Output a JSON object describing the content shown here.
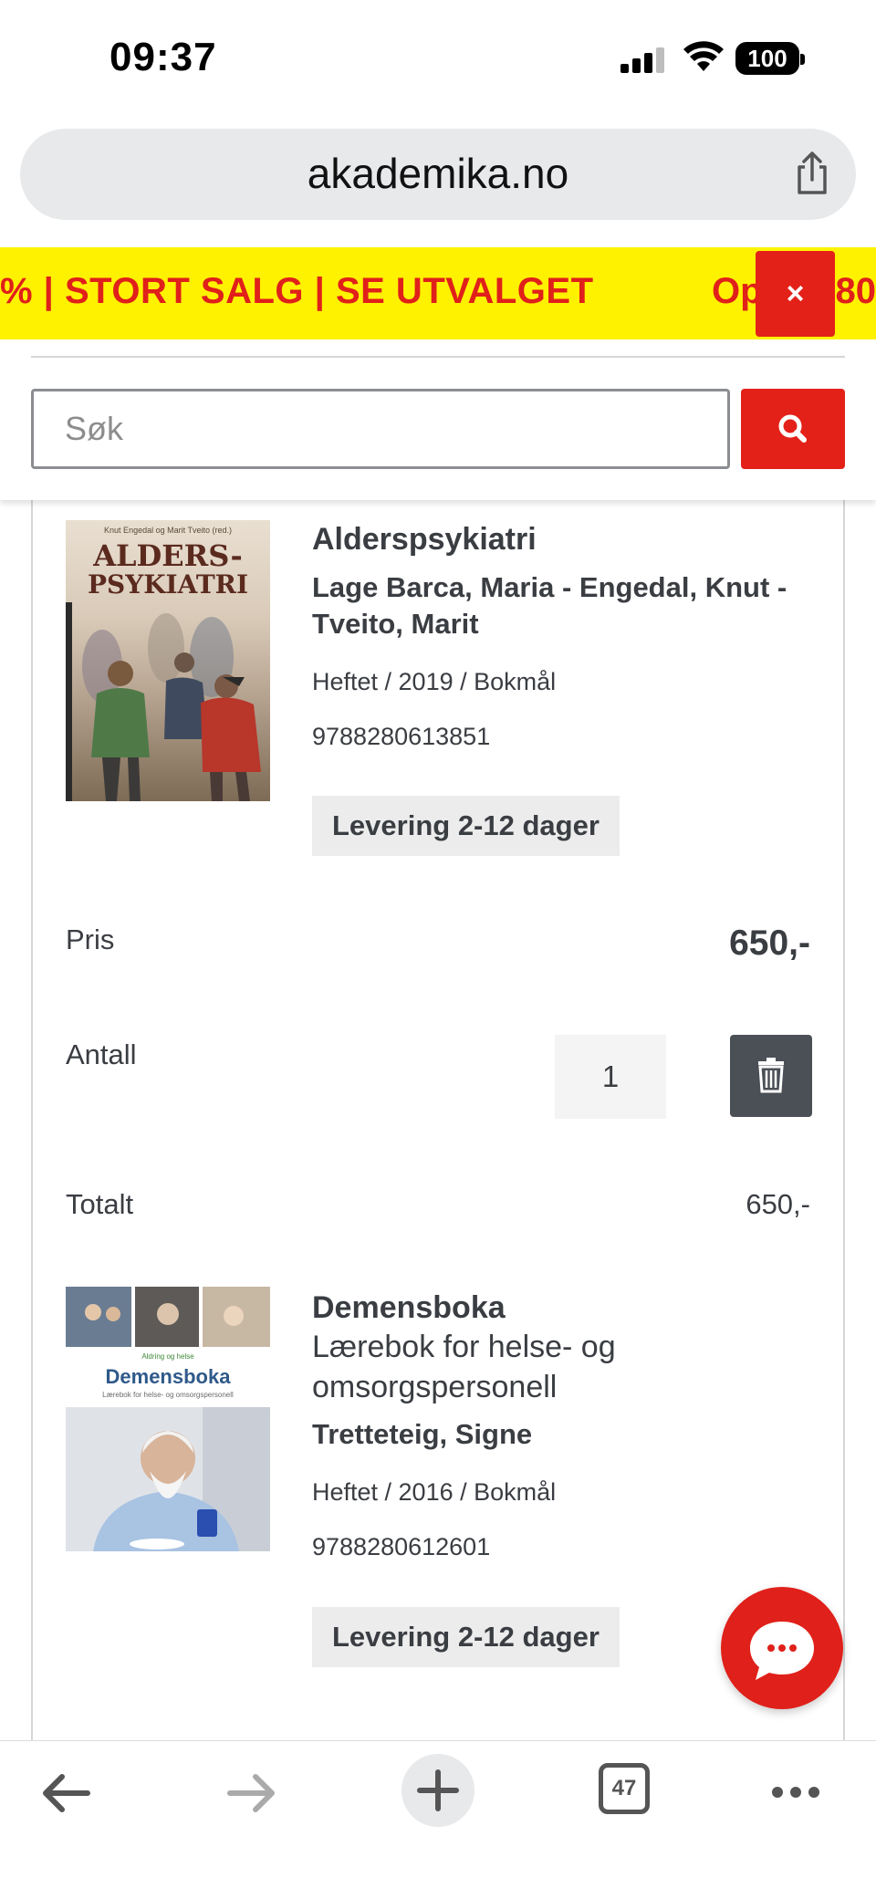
{
  "status_bar": {
    "time": "09:37",
    "battery": "100"
  },
  "browser": {
    "url": "akademika.no",
    "open_tabs": "47"
  },
  "banner": {
    "text": "% | STORT SALG | SE UTVALGET",
    "text_continued": "Op",
    "text_tail": "80",
    "close_label": "×"
  },
  "search": {
    "placeholder": "Søk"
  },
  "cart_items": [
    {
      "title": "Alderspsykiatri",
      "authors": "Lage Barca, Maria - Engedal, Knut - Tveito, Marit",
      "authors_line1": "Lage Barca, Maria - Engedal, Knut -",
      "authors_line2": "Tveito, Marit",
      "format": "Heftet / 2019 / Bokmål",
      "isbn": "9788280613851",
      "delivery": "Levering 2-12 dager",
      "price_label": "Pris",
      "price": "650,-",
      "quantity_label": "Antall",
      "quantity": "1",
      "total_label": "Totalt",
      "total": "650,-",
      "cover": {
        "title_line1": "ALDERS-",
        "title_line2": "PSYKIATRI",
        "editors": "Knut Engedal og Marit Tveito (red.)"
      }
    },
    {
      "title": "Demensboka",
      "subtitle_line1": "Lærebok for helse- og",
      "subtitle_line2": "omsorgspersonell",
      "authors": "Tretteteig, Signe",
      "format": "Heftet / 2016 / Bokmål",
      "isbn": "9788280612601",
      "delivery": "Levering 2-12 dager",
      "cover": {
        "publisher": "Aldring og helse",
        "title": "Demensboka",
        "subtitle": "Lærebok for helse- og omsorgspersonell"
      }
    }
  ],
  "colors": {
    "brand_red": "#e32119",
    "banner_yellow": "#fff200",
    "text": "#3a3d42"
  }
}
